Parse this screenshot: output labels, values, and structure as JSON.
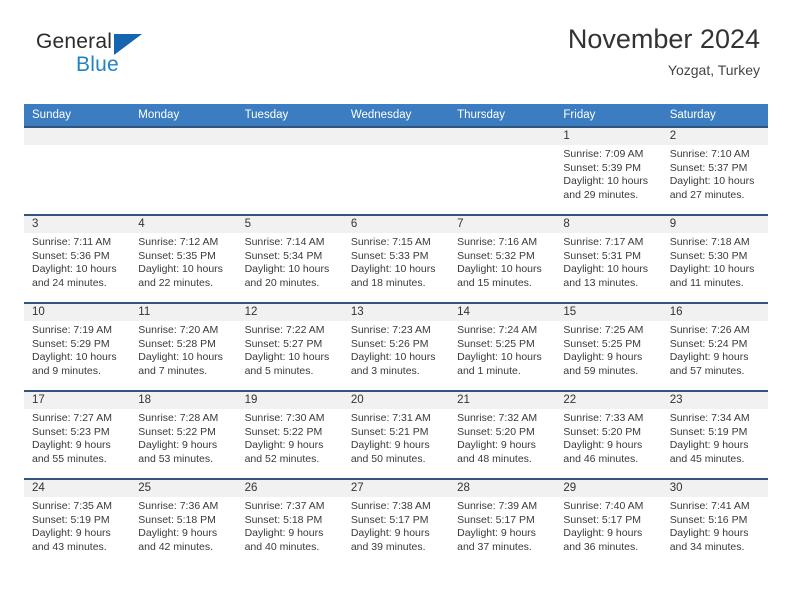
{
  "brand": {
    "name_top": "General",
    "name_bottom": "Blue",
    "triangle_icon": "triangle-icon",
    "accent_dark_blue": "#1565b0",
    "accent_light_blue": "#2383c4"
  },
  "header": {
    "title": "November 2024",
    "subtitle": "Yozgat, Turkey"
  },
  "theme": {
    "header_row_bg": "#3b7dc0",
    "week_border": "#31557f",
    "daynum_bg": "#f1f1f1",
    "text": "#3a3a3a"
  },
  "weekdays": [
    "Sunday",
    "Monday",
    "Tuesday",
    "Wednesday",
    "Thursday",
    "Friday",
    "Saturday"
  ],
  "weeks": [
    [
      {
        "day": "",
        "sunrise": "",
        "sunset": "",
        "daylight_1": "",
        "daylight_2": ""
      },
      {
        "day": "",
        "sunrise": "",
        "sunset": "",
        "daylight_1": "",
        "daylight_2": ""
      },
      {
        "day": "",
        "sunrise": "",
        "sunset": "",
        "daylight_1": "",
        "daylight_2": ""
      },
      {
        "day": "",
        "sunrise": "",
        "sunset": "",
        "daylight_1": "",
        "daylight_2": ""
      },
      {
        "day": "",
        "sunrise": "",
        "sunset": "",
        "daylight_1": "",
        "daylight_2": ""
      },
      {
        "day": "1",
        "sunrise": "Sunrise: 7:09 AM",
        "sunset": "Sunset: 5:39 PM",
        "daylight_1": "Daylight: 10 hours",
        "daylight_2": "and 29 minutes."
      },
      {
        "day": "2",
        "sunrise": "Sunrise: 7:10 AM",
        "sunset": "Sunset: 5:37 PM",
        "daylight_1": "Daylight: 10 hours",
        "daylight_2": "and 27 minutes."
      }
    ],
    [
      {
        "day": "3",
        "sunrise": "Sunrise: 7:11 AM",
        "sunset": "Sunset: 5:36 PM",
        "daylight_1": "Daylight: 10 hours",
        "daylight_2": "and 24 minutes."
      },
      {
        "day": "4",
        "sunrise": "Sunrise: 7:12 AM",
        "sunset": "Sunset: 5:35 PM",
        "daylight_1": "Daylight: 10 hours",
        "daylight_2": "and 22 minutes."
      },
      {
        "day": "5",
        "sunrise": "Sunrise: 7:14 AM",
        "sunset": "Sunset: 5:34 PM",
        "daylight_1": "Daylight: 10 hours",
        "daylight_2": "and 20 minutes."
      },
      {
        "day": "6",
        "sunrise": "Sunrise: 7:15 AM",
        "sunset": "Sunset: 5:33 PM",
        "daylight_1": "Daylight: 10 hours",
        "daylight_2": "and 18 minutes."
      },
      {
        "day": "7",
        "sunrise": "Sunrise: 7:16 AM",
        "sunset": "Sunset: 5:32 PM",
        "daylight_1": "Daylight: 10 hours",
        "daylight_2": "and 15 minutes."
      },
      {
        "day": "8",
        "sunrise": "Sunrise: 7:17 AM",
        "sunset": "Sunset: 5:31 PM",
        "daylight_1": "Daylight: 10 hours",
        "daylight_2": "and 13 minutes."
      },
      {
        "day": "9",
        "sunrise": "Sunrise: 7:18 AM",
        "sunset": "Sunset: 5:30 PM",
        "daylight_1": "Daylight: 10 hours",
        "daylight_2": "and 11 minutes."
      }
    ],
    [
      {
        "day": "10",
        "sunrise": "Sunrise: 7:19 AM",
        "sunset": "Sunset: 5:29 PM",
        "daylight_1": "Daylight: 10 hours",
        "daylight_2": "and 9 minutes."
      },
      {
        "day": "11",
        "sunrise": "Sunrise: 7:20 AM",
        "sunset": "Sunset: 5:28 PM",
        "daylight_1": "Daylight: 10 hours",
        "daylight_2": "and 7 minutes."
      },
      {
        "day": "12",
        "sunrise": "Sunrise: 7:22 AM",
        "sunset": "Sunset: 5:27 PM",
        "daylight_1": "Daylight: 10 hours",
        "daylight_2": "and 5 minutes."
      },
      {
        "day": "13",
        "sunrise": "Sunrise: 7:23 AM",
        "sunset": "Sunset: 5:26 PM",
        "daylight_1": "Daylight: 10 hours",
        "daylight_2": "and 3 minutes."
      },
      {
        "day": "14",
        "sunrise": "Sunrise: 7:24 AM",
        "sunset": "Sunset: 5:25 PM",
        "daylight_1": "Daylight: 10 hours",
        "daylight_2": "and 1 minute."
      },
      {
        "day": "15",
        "sunrise": "Sunrise: 7:25 AM",
        "sunset": "Sunset: 5:25 PM",
        "daylight_1": "Daylight: 9 hours",
        "daylight_2": "and 59 minutes."
      },
      {
        "day": "16",
        "sunrise": "Sunrise: 7:26 AM",
        "sunset": "Sunset: 5:24 PM",
        "daylight_1": "Daylight: 9 hours",
        "daylight_2": "and 57 minutes."
      }
    ],
    [
      {
        "day": "17",
        "sunrise": "Sunrise: 7:27 AM",
        "sunset": "Sunset: 5:23 PM",
        "daylight_1": "Daylight: 9 hours",
        "daylight_2": "and 55 minutes."
      },
      {
        "day": "18",
        "sunrise": "Sunrise: 7:28 AM",
        "sunset": "Sunset: 5:22 PM",
        "daylight_1": "Daylight: 9 hours",
        "daylight_2": "and 53 minutes."
      },
      {
        "day": "19",
        "sunrise": "Sunrise: 7:30 AM",
        "sunset": "Sunset: 5:22 PM",
        "daylight_1": "Daylight: 9 hours",
        "daylight_2": "and 52 minutes."
      },
      {
        "day": "20",
        "sunrise": "Sunrise: 7:31 AM",
        "sunset": "Sunset: 5:21 PM",
        "daylight_1": "Daylight: 9 hours",
        "daylight_2": "and 50 minutes."
      },
      {
        "day": "21",
        "sunrise": "Sunrise: 7:32 AM",
        "sunset": "Sunset: 5:20 PM",
        "daylight_1": "Daylight: 9 hours",
        "daylight_2": "and 48 minutes."
      },
      {
        "day": "22",
        "sunrise": "Sunrise: 7:33 AM",
        "sunset": "Sunset: 5:20 PM",
        "daylight_1": "Daylight: 9 hours",
        "daylight_2": "and 46 minutes."
      },
      {
        "day": "23",
        "sunrise": "Sunrise: 7:34 AM",
        "sunset": "Sunset: 5:19 PM",
        "daylight_1": "Daylight: 9 hours",
        "daylight_2": "and 45 minutes."
      }
    ],
    [
      {
        "day": "24",
        "sunrise": "Sunrise: 7:35 AM",
        "sunset": "Sunset: 5:19 PM",
        "daylight_1": "Daylight: 9 hours",
        "daylight_2": "and 43 minutes."
      },
      {
        "day": "25",
        "sunrise": "Sunrise: 7:36 AM",
        "sunset": "Sunset: 5:18 PM",
        "daylight_1": "Daylight: 9 hours",
        "daylight_2": "and 42 minutes."
      },
      {
        "day": "26",
        "sunrise": "Sunrise: 7:37 AM",
        "sunset": "Sunset: 5:18 PM",
        "daylight_1": "Daylight: 9 hours",
        "daylight_2": "and 40 minutes."
      },
      {
        "day": "27",
        "sunrise": "Sunrise: 7:38 AM",
        "sunset": "Sunset: 5:17 PM",
        "daylight_1": "Daylight: 9 hours",
        "daylight_2": "and 39 minutes."
      },
      {
        "day": "28",
        "sunrise": "Sunrise: 7:39 AM",
        "sunset": "Sunset: 5:17 PM",
        "daylight_1": "Daylight: 9 hours",
        "daylight_2": "and 37 minutes."
      },
      {
        "day": "29",
        "sunrise": "Sunrise: 7:40 AM",
        "sunset": "Sunset: 5:17 PM",
        "daylight_1": "Daylight: 9 hours",
        "daylight_2": "and 36 minutes."
      },
      {
        "day": "30",
        "sunrise": "Sunrise: 7:41 AM",
        "sunset": "Sunset: 5:16 PM",
        "daylight_1": "Daylight: 9 hours",
        "daylight_2": "and 34 minutes."
      }
    ]
  ]
}
